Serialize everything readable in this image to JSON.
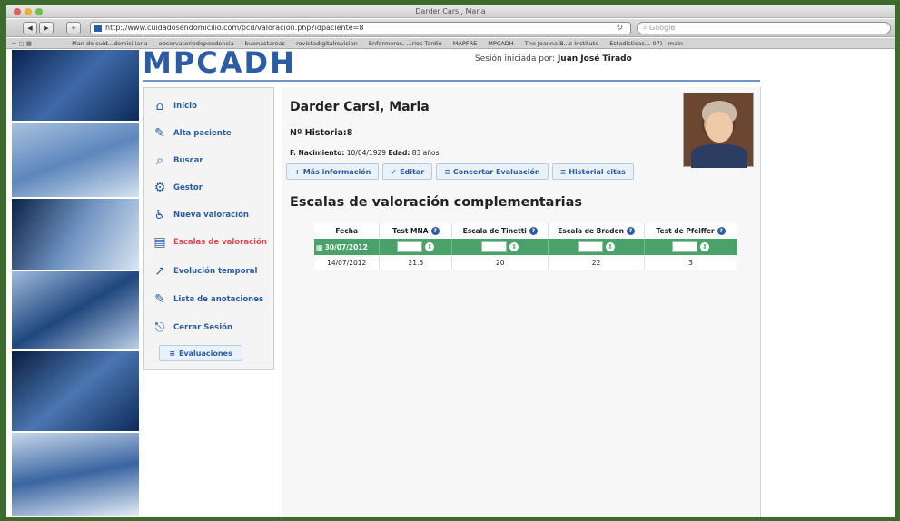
{
  "window": {
    "title": "Darder Carsi, Maria"
  },
  "browser": {
    "url": "http://www.cuidadosendomicilio.com/pcd/valoracion.php?idpaciente=8",
    "search_placeholder": "Google",
    "bookmarks": [
      "Plan de cuid...domiciliaria",
      "observatoriodependencia",
      "buenastareas",
      "revistadigitalrevision",
      "Enfermeros, ...rios Tardio",
      "MAPFRE",
      "MPCADH",
      "The Joanna B...s Institute",
      "Estadísticas...-07) - main"
    ]
  },
  "header": {
    "logo": "MPCADH",
    "session_label": "Sesión iniciada por:",
    "session_user": "Juan José Tirado"
  },
  "menu": {
    "items": [
      {
        "label": "Inicio",
        "icon": "home-icon"
      },
      {
        "label": "Alta paciente",
        "icon": "pencil-icon"
      },
      {
        "label": "Buscar",
        "icon": "magnifier-icon"
      },
      {
        "label": "Gestor",
        "icon": "gears-icon"
      },
      {
        "label": "Nueva valoración",
        "icon": "wheelchair-icon"
      },
      {
        "label": "Escalas de valoración",
        "icon": "ruler-icon",
        "active": true
      },
      {
        "label": "Evolución temporal",
        "icon": "chart-icon"
      },
      {
        "label": "Lista de anotaciones",
        "icon": "pencil-icon"
      },
      {
        "label": "Cerrar Sesión",
        "icon": "logout-icon"
      }
    ],
    "evaluations_button": "Evaluaciones"
  },
  "patient": {
    "name": "Darder Carsi, Maria",
    "history_label": "Nº Historia:",
    "history_number": "8",
    "birth_label": "F. Nacimiento:",
    "birth_date": "10/04/1929",
    "age_label": "Edad:",
    "age": "83 años"
  },
  "actions": [
    {
      "label": "Más información",
      "icon": "plus-icon"
    },
    {
      "label": "Editar",
      "icon": "edit-icon"
    },
    {
      "label": "Concertar Evaluación",
      "icon": "list-icon"
    },
    {
      "label": "Historial citas",
      "icon": "list-icon"
    }
  ],
  "scales": {
    "title": "Escalas de valoración complementarias",
    "columns": [
      "Fecha",
      "Test MNA",
      "Escala de Tinetti",
      "Escala de Braden",
      "Test de Pfeiffer"
    ],
    "new_row_date": "30/07/2012",
    "rows": [
      {
        "date": "14/07/2012",
        "values": [
          "21.5",
          "20",
          "22",
          "3"
        ]
      }
    ]
  },
  "colors": {
    "accent": "#2c5da3",
    "active_menu": "#e0484f",
    "new_row": "#4aa26a",
    "frame": "#3d6b2f"
  }
}
